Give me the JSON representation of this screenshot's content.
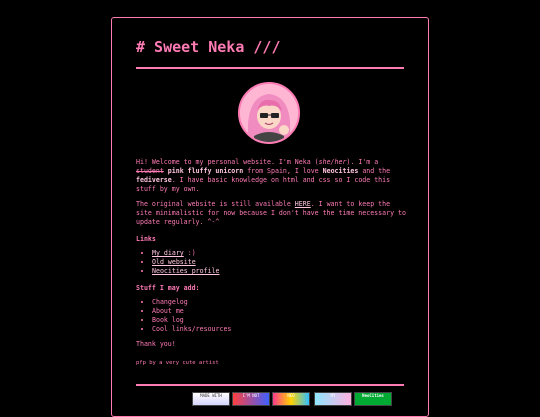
{
  "header": {
    "title": "# Sweet Neka ///"
  },
  "intro": {
    "p1_a": "Hi! Welcome to my personal website. I'm Neka (",
    "p1_pronoun": "she/her",
    "p1_b": "). I'm a ",
    "p1_strike": "student",
    "p1_c": " ",
    "p1_bold1": "pink fluffy unicorn",
    "p1_d": " from Spain, I love ",
    "p1_bold2": "Neocities",
    "p1_e": " and the ",
    "p1_bold3": "fediverse",
    "p1_f": ". I have basic knowledge on html and css so I code this stuff by my own.",
    "p2_a": "The original website is still available ",
    "p2_link": "HERE",
    "p2_b": ". I want to keep the site minimalistic for now because I don't have the time necessary to update regularly. ^-^"
  },
  "links": {
    "heading": "Links",
    "items": [
      {
        "label": "My diary",
        "suffix": " :)"
      },
      {
        "label": "Old website",
        "suffix": ""
      },
      {
        "label": "Neocities profile",
        "suffix": ""
      }
    ]
  },
  "todo": {
    "heading": "Stuff I may add:",
    "items": [
      "Changelog",
      "About me",
      "Book log",
      "Cool links/resources"
    ]
  },
  "thanks": "Thank you!",
  "credit": "pfp by a very cute artist",
  "badges": [
    {
      "name": "badge-1",
      "label": "MADE WITH"
    },
    {
      "name": "badge-2",
      "label": "I'M NOT"
    },
    {
      "name": "badge-3",
      "label": "NEO"
    },
    {
      "name": "badge-4",
      "label": "MY"
    },
    {
      "name": "badge-5",
      "label": "NeoCities"
    }
  ],
  "colors": {
    "accent": "#ff7bb4",
    "highlight": "#ffc4dd",
    "background": "#000000"
  }
}
